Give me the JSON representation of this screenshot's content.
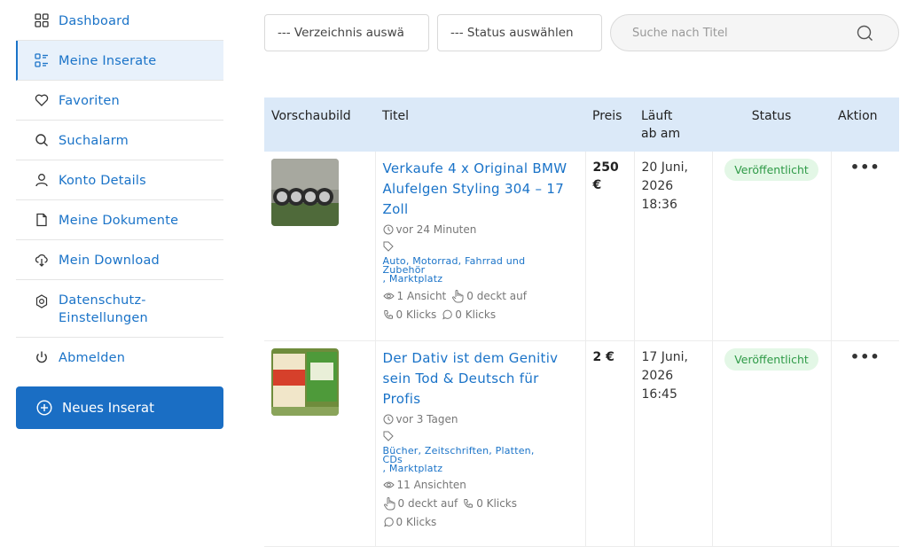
{
  "sidebar": {
    "items": [
      {
        "label": "Dashboard",
        "icon": "grid-icon",
        "active": false
      },
      {
        "label": "Meine Inserate",
        "icon": "list-icon",
        "active": true
      },
      {
        "label": "Favoriten",
        "icon": "heart-icon",
        "active": false
      },
      {
        "label": "Suchalarm",
        "icon": "search-icon",
        "active": false
      },
      {
        "label": "Konto Details",
        "icon": "user-icon",
        "active": false
      },
      {
        "label": "Meine Dokumente",
        "icon": "document-icon",
        "active": false
      },
      {
        "label": "Mein Download",
        "icon": "cloud-download-icon",
        "active": false
      },
      {
        "label_line1": "Datenschutz-",
        "label_line2": "Einstellungen",
        "icon": "settings-icon",
        "active": false
      },
      {
        "label": "Abmelden",
        "icon": "power-icon",
        "active": false
      }
    ],
    "new_button": "Neues Inserat"
  },
  "filters": {
    "directory": "--- Verzeichnis auswä",
    "status": "--- Status auswählen",
    "search_placeholder": "Suche nach Titel"
  },
  "table": {
    "headers": {
      "preview": "Vorschaubild",
      "title": "Titel",
      "price": "Preis",
      "runs_from_1": "Läuft",
      "runs_from_2": "ab am",
      "status": "Status",
      "action": "Aktion"
    },
    "rows": [
      {
        "title": "Verkaufe 4 x Original BMW Alufelgen Styling 304 – 17 Zoll",
        "age": "vor 24 Minuten",
        "cat1_l1": "Auto, Motorrad, Fahrrad und",
        "cat1_l2": "Zubehör",
        "cat2": ", Marktplatz",
        "views": "1 Ansicht",
        "reveals": "0 deckt auf",
        "clicks": "0 Klicks",
        "wa_clicks": "0 Klicks",
        "price_l1": "250",
        "price_l2": "€",
        "date_l1": "20 Juni,",
        "date_l2": "2026",
        "date_l3": "18:36",
        "status": "Veröffentlicht",
        "action": "•••"
      },
      {
        "title": "Der Dativ ist dem Genitiv sein Tod & Deutsch für Profis",
        "age": "vor 3 Tagen",
        "cat1_l1": "Bücher, Zeitschriften, Platten,",
        "cat1_l2": "CDs",
        "cat2": ", Marktplatz",
        "views": "11 Ansichten",
        "reveals": "0 deckt auf",
        "clicks": "0 Klicks",
        "wa_clicks": "0 Klicks",
        "price_l1": "2 €",
        "date_l1": "17 Juni,",
        "date_l2": "2026",
        "date_l3": "16:45",
        "status": "Veröffentlicht",
        "action": "•••"
      }
    ]
  },
  "colors": {
    "accent": "#1a73c8",
    "button": "#1a6ec4",
    "header_bg": "#dbe9f8",
    "badge_bg": "#e3f7e6",
    "badge_text": "#2e9a47"
  }
}
